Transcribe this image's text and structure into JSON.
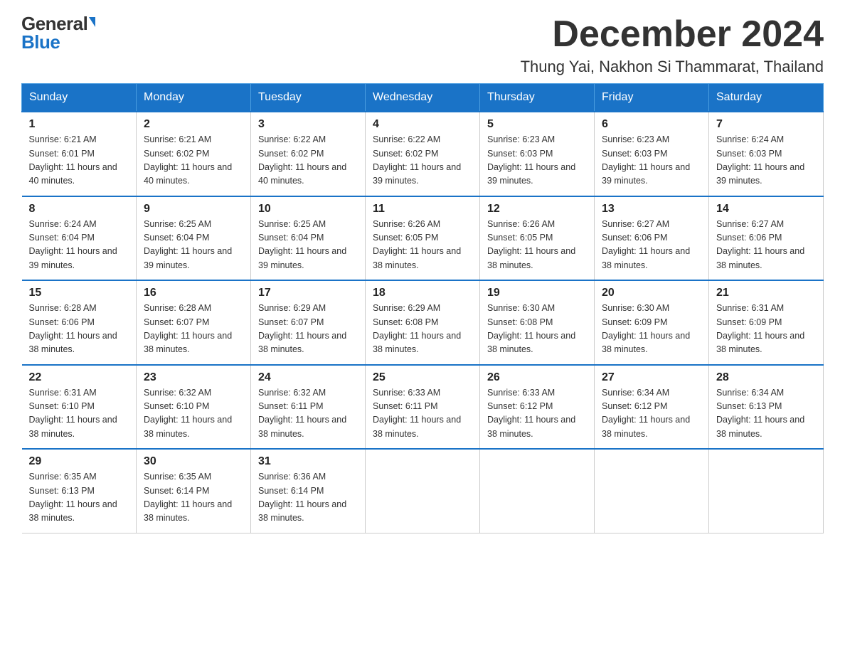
{
  "header": {
    "logo_general": "General",
    "logo_blue": "Blue",
    "month_title": "December 2024",
    "location": "Thung Yai, Nakhon Si Thammarat, Thailand"
  },
  "weekdays": [
    "Sunday",
    "Monday",
    "Tuesday",
    "Wednesday",
    "Thursday",
    "Friday",
    "Saturday"
  ],
  "weeks": [
    [
      {
        "day": "1",
        "sunrise": "6:21 AM",
        "sunset": "6:01 PM",
        "daylight": "11 hours and 40 minutes."
      },
      {
        "day": "2",
        "sunrise": "6:21 AM",
        "sunset": "6:02 PM",
        "daylight": "11 hours and 40 minutes."
      },
      {
        "day": "3",
        "sunrise": "6:22 AM",
        "sunset": "6:02 PM",
        "daylight": "11 hours and 40 minutes."
      },
      {
        "day": "4",
        "sunrise": "6:22 AM",
        "sunset": "6:02 PM",
        "daylight": "11 hours and 39 minutes."
      },
      {
        "day": "5",
        "sunrise": "6:23 AM",
        "sunset": "6:03 PM",
        "daylight": "11 hours and 39 minutes."
      },
      {
        "day": "6",
        "sunrise": "6:23 AM",
        "sunset": "6:03 PM",
        "daylight": "11 hours and 39 minutes."
      },
      {
        "day": "7",
        "sunrise": "6:24 AM",
        "sunset": "6:03 PM",
        "daylight": "11 hours and 39 minutes."
      }
    ],
    [
      {
        "day": "8",
        "sunrise": "6:24 AM",
        "sunset": "6:04 PM",
        "daylight": "11 hours and 39 minutes."
      },
      {
        "day": "9",
        "sunrise": "6:25 AM",
        "sunset": "6:04 PM",
        "daylight": "11 hours and 39 minutes."
      },
      {
        "day": "10",
        "sunrise": "6:25 AM",
        "sunset": "6:04 PM",
        "daylight": "11 hours and 39 minutes."
      },
      {
        "day": "11",
        "sunrise": "6:26 AM",
        "sunset": "6:05 PM",
        "daylight": "11 hours and 38 minutes."
      },
      {
        "day": "12",
        "sunrise": "6:26 AM",
        "sunset": "6:05 PM",
        "daylight": "11 hours and 38 minutes."
      },
      {
        "day": "13",
        "sunrise": "6:27 AM",
        "sunset": "6:06 PM",
        "daylight": "11 hours and 38 minutes."
      },
      {
        "day": "14",
        "sunrise": "6:27 AM",
        "sunset": "6:06 PM",
        "daylight": "11 hours and 38 minutes."
      }
    ],
    [
      {
        "day": "15",
        "sunrise": "6:28 AM",
        "sunset": "6:06 PM",
        "daylight": "11 hours and 38 minutes."
      },
      {
        "day": "16",
        "sunrise": "6:28 AM",
        "sunset": "6:07 PM",
        "daylight": "11 hours and 38 minutes."
      },
      {
        "day": "17",
        "sunrise": "6:29 AM",
        "sunset": "6:07 PM",
        "daylight": "11 hours and 38 minutes."
      },
      {
        "day": "18",
        "sunrise": "6:29 AM",
        "sunset": "6:08 PM",
        "daylight": "11 hours and 38 minutes."
      },
      {
        "day": "19",
        "sunrise": "6:30 AM",
        "sunset": "6:08 PM",
        "daylight": "11 hours and 38 minutes."
      },
      {
        "day": "20",
        "sunrise": "6:30 AM",
        "sunset": "6:09 PM",
        "daylight": "11 hours and 38 minutes."
      },
      {
        "day": "21",
        "sunrise": "6:31 AM",
        "sunset": "6:09 PM",
        "daylight": "11 hours and 38 minutes."
      }
    ],
    [
      {
        "day": "22",
        "sunrise": "6:31 AM",
        "sunset": "6:10 PM",
        "daylight": "11 hours and 38 minutes."
      },
      {
        "day": "23",
        "sunrise": "6:32 AM",
        "sunset": "6:10 PM",
        "daylight": "11 hours and 38 minutes."
      },
      {
        "day": "24",
        "sunrise": "6:32 AM",
        "sunset": "6:11 PM",
        "daylight": "11 hours and 38 minutes."
      },
      {
        "day": "25",
        "sunrise": "6:33 AM",
        "sunset": "6:11 PM",
        "daylight": "11 hours and 38 minutes."
      },
      {
        "day": "26",
        "sunrise": "6:33 AM",
        "sunset": "6:12 PM",
        "daylight": "11 hours and 38 minutes."
      },
      {
        "day": "27",
        "sunrise": "6:34 AM",
        "sunset": "6:12 PM",
        "daylight": "11 hours and 38 minutes."
      },
      {
        "day": "28",
        "sunrise": "6:34 AM",
        "sunset": "6:13 PM",
        "daylight": "11 hours and 38 minutes."
      }
    ],
    [
      {
        "day": "29",
        "sunrise": "6:35 AM",
        "sunset": "6:13 PM",
        "daylight": "11 hours and 38 minutes."
      },
      {
        "day": "30",
        "sunrise": "6:35 AM",
        "sunset": "6:14 PM",
        "daylight": "11 hours and 38 minutes."
      },
      {
        "day": "31",
        "sunrise": "6:36 AM",
        "sunset": "6:14 PM",
        "daylight": "11 hours and 38 minutes."
      },
      null,
      null,
      null,
      null
    ]
  ],
  "labels": {
    "sunrise": "Sunrise:",
    "sunset": "Sunset:",
    "daylight": "Daylight:"
  }
}
